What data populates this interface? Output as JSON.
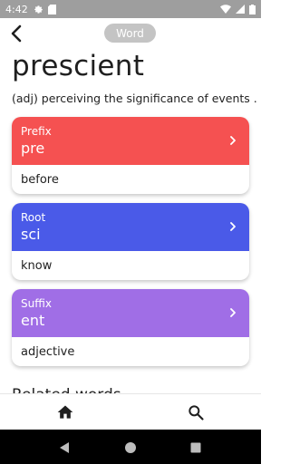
{
  "status_bar": {
    "time": "4:42",
    "left_icons": [
      "gear-icon",
      "sd-card-icon"
    ],
    "right_icons": [
      "wifi-icon",
      "cell-signal-icon",
      "battery-icon"
    ]
  },
  "header": {
    "back_icon": "back-arrow-icon",
    "chip_label": "Word"
  },
  "word": {
    "title": "prescient",
    "definition": "(adj) perceiving the significance of events ..."
  },
  "parts": [
    {
      "kind": "Prefix",
      "part": "pre",
      "meaning": "before",
      "color": "#f55151"
    },
    {
      "kind": "Root",
      "part": "sci",
      "meaning": "know",
      "color": "#4a5ae8"
    },
    {
      "kind": "Suffix",
      "part": "ent",
      "meaning": "adjective",
      "color": "#a06ee6"
    }
  ],
  "related_section": {
    "title": "Related words"
  },
  "bottom_nav": {
    "items": [
      {
        "icon": "home-icon"
      },
      {
        "icon": "search-icon"
      }
    ]
  },
  "android_nav": [
    "back-triangle-icon",
    "home-circle-icon",
    "recents-square-icon"
  ]
}
